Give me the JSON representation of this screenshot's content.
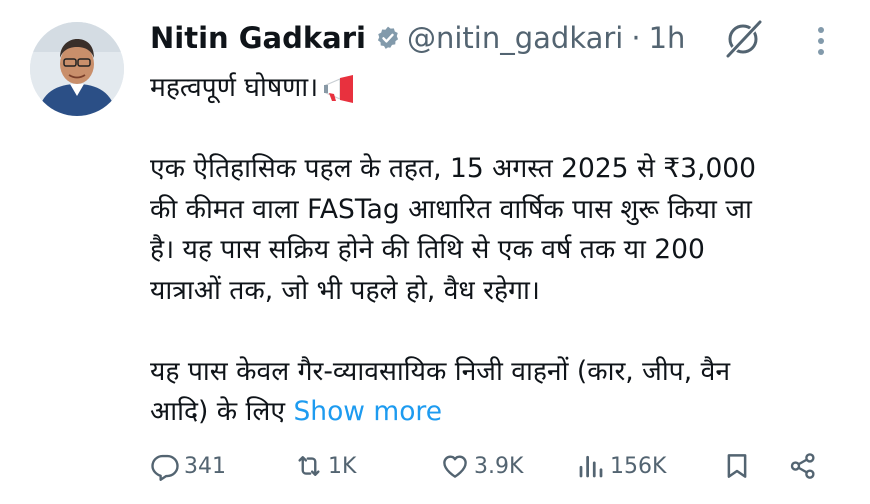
{
  "author": {
    "name": "Nitin Gadkari",
    "handle": "@nitin_gadkari",
    "separator": "·",
    "time": "1h"
  },
  "tweet": {
    "line1": "महत्वपूर्ण घोषणा।",
    "line2": "एक ऐतिहासिक पहल के तहत, 15 अगस्त 2025 से ₹3,000",
    "line3": "की कीमत वाला FASTag आधारित वार्षिक पास शुरू किया जा",
    "line4": "है। यह पास सक्रिय होने की तिथि से एक वर्ष तक या 200",
    "line5": "यात्राओं तक, जो भी पहले हो, वैध रहेगा।",
    "line6": "यह पास केवल गैर-व्यावसायिक निजी वाहनों (कार, जीप, वैन",
    "line7": "आदि) के लिए ",
    "show_more": "Show more"
  },
  "actions": {
    "replies": "341",
    "reposts": "1K",
    "likes": "3.9K",
    "views": "156K"
  },
  "icons": {
    "verified": "verified-badge-icon",
    "grok": "grok-icon",
    "more": "more-options-icon",
    "megaphone": "megaphone-emoji",
    "reply": "reply-icon",
    "repost": "repost-icon",
    "like": "like-icon",
    "views": "views-icon",
    "bookmark": "bookmark-icon",
    "share": "share-icon"
  },
  "colors": {
    "text": "#0f1419",
    "muted": "#536471",
    "link": "#1d9bf0",
    "verified": "#829aab"
  }
}
